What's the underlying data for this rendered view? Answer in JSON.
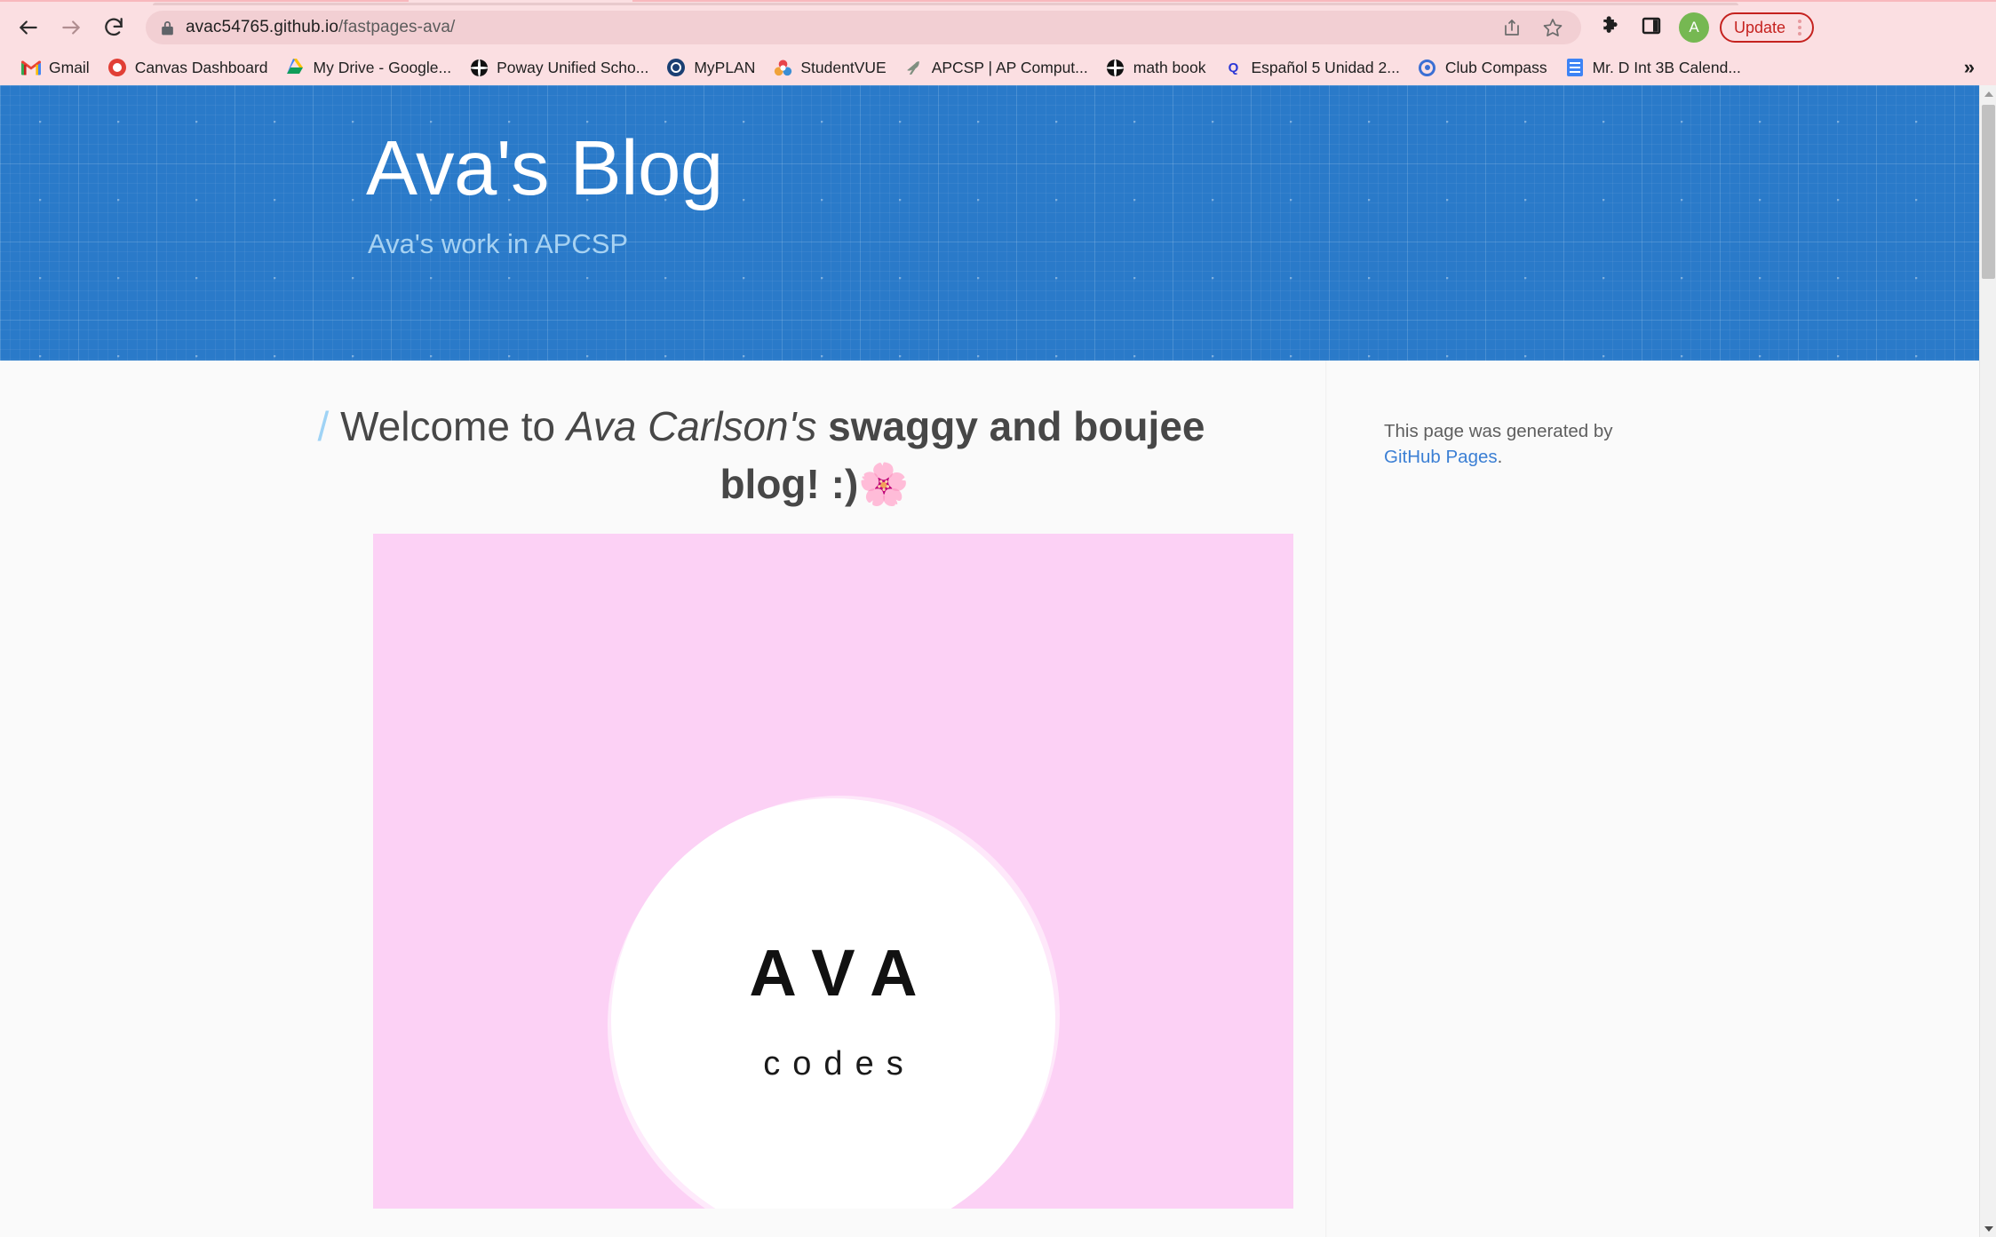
{
  "browser": {
    "nav": {
      "back_label": "Back",
      "forward_label": "Forward",
      "reload_label": "Reload"
    },
    "omnibox": {
      "lock_icon": "lock-icon",
      "url_domain": "avac54765.github.io",
      "url_path": "/fastpages-ava/",
      "share_icon": "share-icon",
      "bookmark_icon": "star-icon"
    },
    "toolbar": {
      "extensions_icon": "puzzle-piece-icon",
      "sidepanel_icon": "side-panel-icon",
      "avatar_initial": "A",
      "update_label": "Update",
      "menu_icon": "kebab-menu-icon"
    },
    "bookmarks": [
      {
        "label": "Gmail",
        "icon": "gmail-icon"
      },
      {
        "label": "Canvas Dashboard",
        "icon": "canvas-icon"
      },
      {
        "label": "My Drive - Google...",
        "icon": "google-drive-icon"
      },
      {
        "label": "Poway Unified Scho...",
        "icon": "globe-icon"
      },
      {
        "label": "MyPLAN",
        "icon": "myplan-icon"
      },
      {
        "label": "StudentVUE",
        "icon": "studentvue-icon"
      },
      {
        "label": "APCSP | AP Comput...",
        "icon": "bird-icon"
      },
      {
        "label": "math book",
        "icon": "globe-icon"
      },
      {
        "label": "Español 5 Unidad 2...",
        "icon": "quizlet-icon"
      },
      {
        "label": "Club Compass",
        "icon": "target-icon"
      },
      {
        "label": "Mr. D Int 3B Calend...",
        "icon": "calendar-icon"
      }
    ],
    "bookmarks_overflow": "»"
  },
  "site": {
    "header": {
      "title": "Ava's Blog",
      "tagline": "Ava's work in APCSP",
      "background_color": "#2a7ac9"
    },
    "post": {
      "slash": "/",
      "title_plain_1": " Welcome to ",
      "title_italic": "Ava Carlson's",
      "title_bold": " swaggy and boujee blog! :)",
      "title_emoji": "🌸",
      "image": {
        "background_color": "#fcd1f5",
        "logo_primary": "AVA",
        "logo_secondary": "codes"
      }
    },
    "sidebar": {
      "note_prefix": "This page was generated by ",
      "note_link": "GitHub Pages",
      "note_suffix": "."
    }
  },
  "scrollbar": {
    "up_arrow": "scroll-up-arrow",
    "down_arrow": "scroll-down-arrow"
  }
}
